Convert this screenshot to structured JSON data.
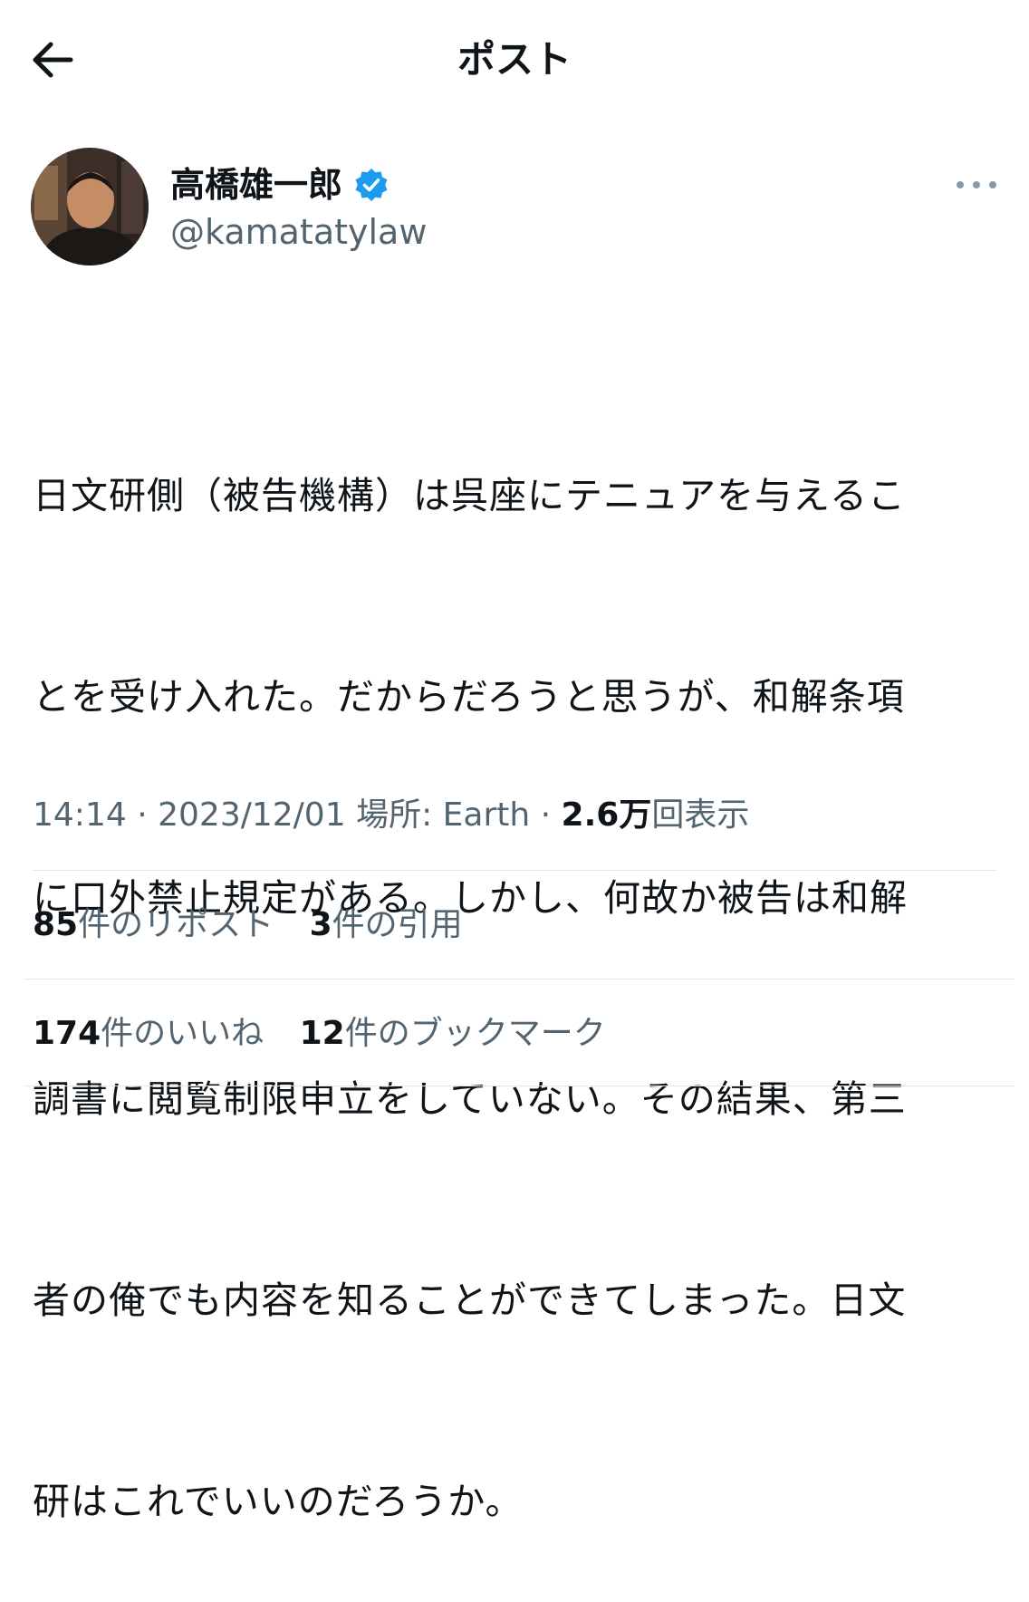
{
  "header": {
    "title": "ポスト",
    "back_icon": "arrow-left-icon"
  },
  "author": {
    "name": "高橋雄一郎",
    "handle": "@kamatatylaw",
    "verified_icon": "verified-badge-icon",
    "verified_color": "#1d9bf0"
  },
  "more_icon": "more-horizontal-icon",
  "tweet": {
    "lines": [
      "日文研側（被告機構）は呉座にテニュアを与えるこ",
      "とを受け入れた。だからだろうと思うが、和解条項",
      "に口外禁止規定がある。しかし、何故か被告は和解",
      "調書に閲覧制限申立をしていない。その結果、第三",
      "者の俺でも内容を知ることができてしまった。日文",
      "研はこれでいいのだろうか。"
    ]
  },
  "meta": {
    "time": "14:14",
    "sep1": "·",
    "date": "2023/12/01",
    "location_label": "場所: Earth",
    "sep2": "·",
    "views_count": "2.6万",
    "views_label": "回表示"
  },
  "stats": {
    "reposts_count": "85",
    "reposts_label": "件のリポスト",
    "quotes_count": "3",
    "quotes_label": "件の引用",
    "likes_count": "174",
    "likes_label": "件のいいね",
    "bookmarks_count": "12",
    "bookmarks_label": "件のブックマーク"
  }
}
